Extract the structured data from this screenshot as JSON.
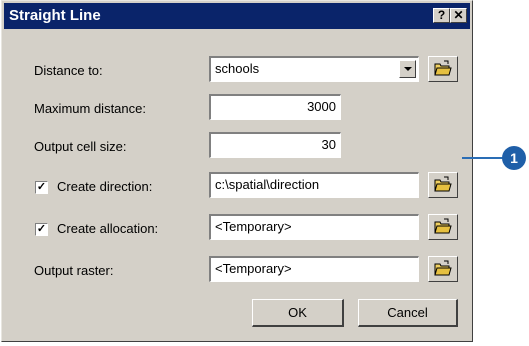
{
  "window": {
    "title": "Straight Line",
    "help_label": "?",
    "close_label": "✕"
  },
  "form": {
    "distance_to": {
      "label": "Distance to:",
      "value": "schools"
    },
    "max_distance": {
      "label": "Maximum distance:",
      "value": "3000"
    },
    "cell_size": {
      "label": "Output cell size:",
      "value": "30"
    },
    "create_direction": {
      "label": "Create direction:",
      "checked_mark": "✓",
      "value": "c:\\spatial\\direction"
    },
    "create_allocation": {
      "label": "Create allocation:",
      "checked_mark": "✓",
      "value": "<Temporary>"
    },
    "output_raster": {
      "label": "Output raster:",
      "value": "<Temporary>"
    }
  },
  "buttons": {
    "ok": "OK",
    "cancel": "Cancel"
  },
  "callout": {
    "number": "1"
  },
  "icons": {
    "browse": "open-folder-icon",
    "dropdown": "chevron-down-icon"
  },
  "colors": {
    "titlebar": "#0a246a",
    "dialog": "#d4d0c8",
    "callout": "#1f5fa8"
  }
}
